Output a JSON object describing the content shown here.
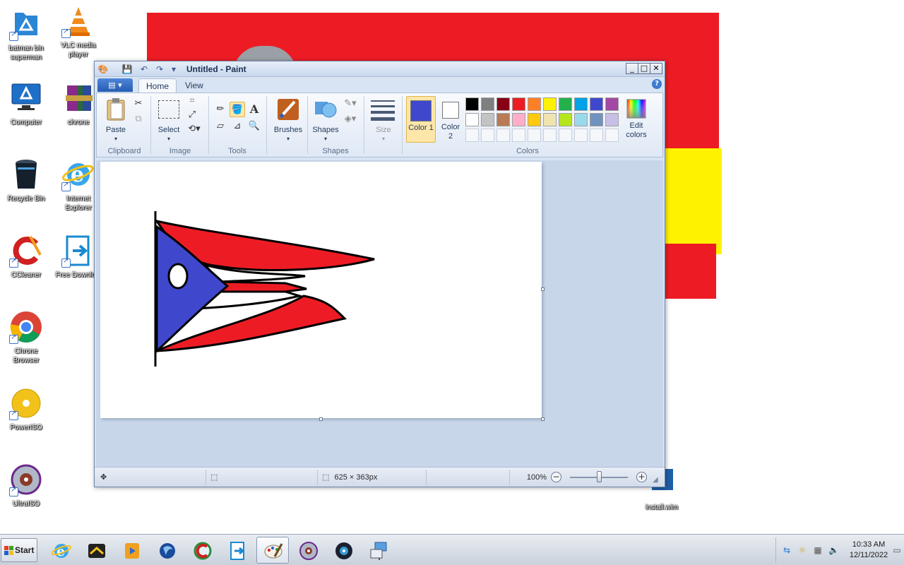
{
  "desktop": {
    "icons": [
      {
        "label": "batman bin superman",
        "icon": "app-icon"
      },
      {
        "label": "VLC media player",
        "icon": "vlc-icon"
      },
      {
        "label": "Computer",
        "icon": "computer-icon"
      },
      {
        "label": "chrone",
        "icon": "winrar-icon"
      },
      {
        "label": "Recycle Bin",
        "icon": "recycle-bin-icon"
      },
      {
        "label": "Internet Explorer",
        "icon": "internet-explorer-icon"
      },
      {
        "label": "CCleaner",
        "icon": "ccleaner-icon"
      },
      {
        "label": "Free Downlo...",
        "icon": "free-download-manager-icon"
      },
      {
        "label": "Chrone Browser",
        "icon": "chrome-icon"
      },
      {
        "label": "PowerISO",
        "icon": "poweriso-icon"
      },
      {
        "label": "UltraISO",
        "icon": "ultraiso-icon"
      },
      {
        "label": "install.wim",
        "icon": "wim-file-icon"
      }
    ]
  },
  "paint": {
    "title": "Untitled - Paint",
    "tabs": [
      "Home",
      "View"
    ],
    "groups": {
      "clipboard": {
        "label": "Clipboard",
        "paste": "Paste"
      },
      "image": {
        "label": "Image",
        "select": "Select"
      },
      "tools": {
        "label": "Tools"
      },
      "brushes": {
        "label": "Brushes"
      },
      "shapes": {
        "label": "Shapes",
        "shapes_btn": "Shapes",
        "size": "Size"
      },
      "colors": {
        "label": "Colors",
        "color1": "Color 1",
        "color2": "Color 2",
        "edit": "Edit colors",
        "color1_value": "#3f48cc",
        "color2_value": "#ffffff",
        "palette_row1": [
          "#000000",
          "#7f7f7f",
          "#880015",
          "#ed1c24",
          "#ff7f27",
          "#fff200",
          "#22b14c",
          "#00a2e8",
          "#3f48cc",
          "#a349a4"
        ],
        "palette_row2": [
          "#ffffff",
          "#c3c3c3",
          "#b97a57",
          "#ffaec9",
          "#ffc90e",
          "#efe4b0",
          "#b5e61d",
          "#99d9ea",
          "#7092be",
          "#c8bfe7"
        ]
      }
    },
    "status": {
      "dimensions": "625 × 363px",
      "zoom": "100%",
      "zoom_level": 0.5
    }
  },
  "taskbar": {
    "start": "Start",
    "apps": [
      "internet-explorer-icon",
      "media-center-icon",
      "media-player-icon",
      "browser-icon",
      "ccleaner-icon",
      "free-download-manager-icon",
      "paint-icon",
      "ultraiso-icon",
      "poweriso-icon",
      "network-icon"
    ],
    "clock_time": "10:33 AM",
    "clock_date": "12/11/2022"
  },
  "colors": {
    "flag_red": "#ed1c24",
    "flag_blue": "#3f48cc",
    "wallpaper_yellow": "#fff200"
  }
}
